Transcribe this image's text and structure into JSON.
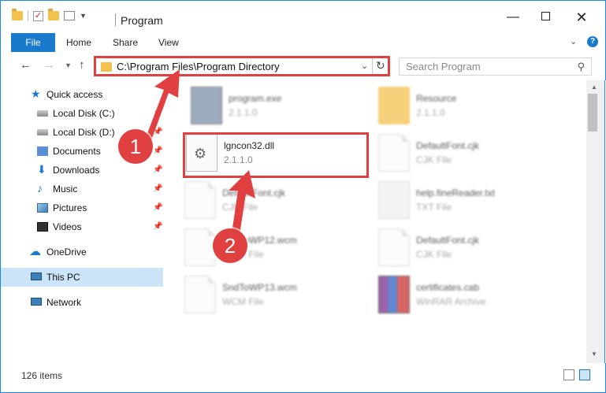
{
  "window": {
    "title": "Program",
    "minimize": "—",
    "close": "✕"
  },
  "ribbon": {
    "tabs": [
      "File",
      "Home",
      "Share",
      "View"
    ],
    "help": "?"
  },
  "address": {
    "path": "C:\\Program Files\\Program Directory",
    "search_placeholder": "Search Program"
  },
  "sidebar": {
    "items": [
      {
        "label": "Quick access",
        "icon": "star-icon",
        "pinned": false
      },
      {
        "label": "Local Disk (C:)",
        "icon": "drive-icon",
        "pinned": true
      },
      {
        "label": "Local Disk (D:)",
        "icon": "drive-icon",
        "pinned": true
      },
      {
        "label": "Documents",
        "icon": "documents-icon",
        "pinned": true
      },
      {
        "label": "Downloads",
        "icon": "download-icon",
        "pinned": true
      },
      {
        "label": "Music",
        "icon": "music-icon",
        "pinned": true
      },
      {
        "label": "Pictures",
        "icon": "pictures-icon",
        "pinned": true
      },
      {
        "label": "Videos",
        "icon": "videos-icon",
        "pinned": true
      },
      {
        "label": "OneDrive",
        "icon": "cloud-icon",
        "pinned": false
      },
      {
        "label": "This PC",
        "icon": "computer-icon",
        "pinned": false,
        "selected": true
      },
      {
        "label": "Network",
        "icon": "network-icon",
        "pinned": false
      }
    ]
  },
  "files": [
    {
      "name": "program.exe",
      "meta": "2.1.1.0",
      "icon": "exe-icon",
      "blurred": true
    },
    {
      "name": "Resource",
      "meta": "2.1.1.0",
      "icon": "folder-icon",
      "blurred": true
    },
    {
      "name": "lgncon32.dll",
      "meta": "2.1.1.0",
      "icon": "dll-icon",
      "blurred": false,
      "highlighted": true
    },
    {
      "name": "DefaultFont.cjk",
      "meta": "CJK File",
      "icon": "file-icon",
      "blurred": true
    },
    {
      "name": "DefaultFont.cjk",
      "meta": "CJK File",
      "icon": "file-icon",
      "blurred": true
    },
    {
      "name": "help.fineReader.txt",
      "meta": "TXT File",
      "icon": "txt-icon",
      "blurred": true
    },
    {
      "name": "SndToWP12.wcm",
      "meta": "WCM File",
      "icon": "file-icon",
      "blurred": true
    },
    {
      "name": "DefaultFont.cjk",
      "meta": "CJK File",
      "icon": "file-icon",
      "blurred": true
    },
    {
      "name": "SndToWP13.wcm",
      "meta": "WCM File",
      "icon": "file-icon",
      "blurred": true
    },
    {
      "name": "certificates.cab",
      "meta": "WinRAR Archive",
      "icon": "archive-icon",
      "blurred": true
    }
  ],
  "status": {
    "count": "126 items"
  },
  "annotations": {
    "step1": "1",
    "step2": "2",
    "color": "#e04040"
  },
  "colors": {
    "accent": "#1979ca",
    "selection": "#cce4f7",
    "highlight": "#e04040"
  }
}
